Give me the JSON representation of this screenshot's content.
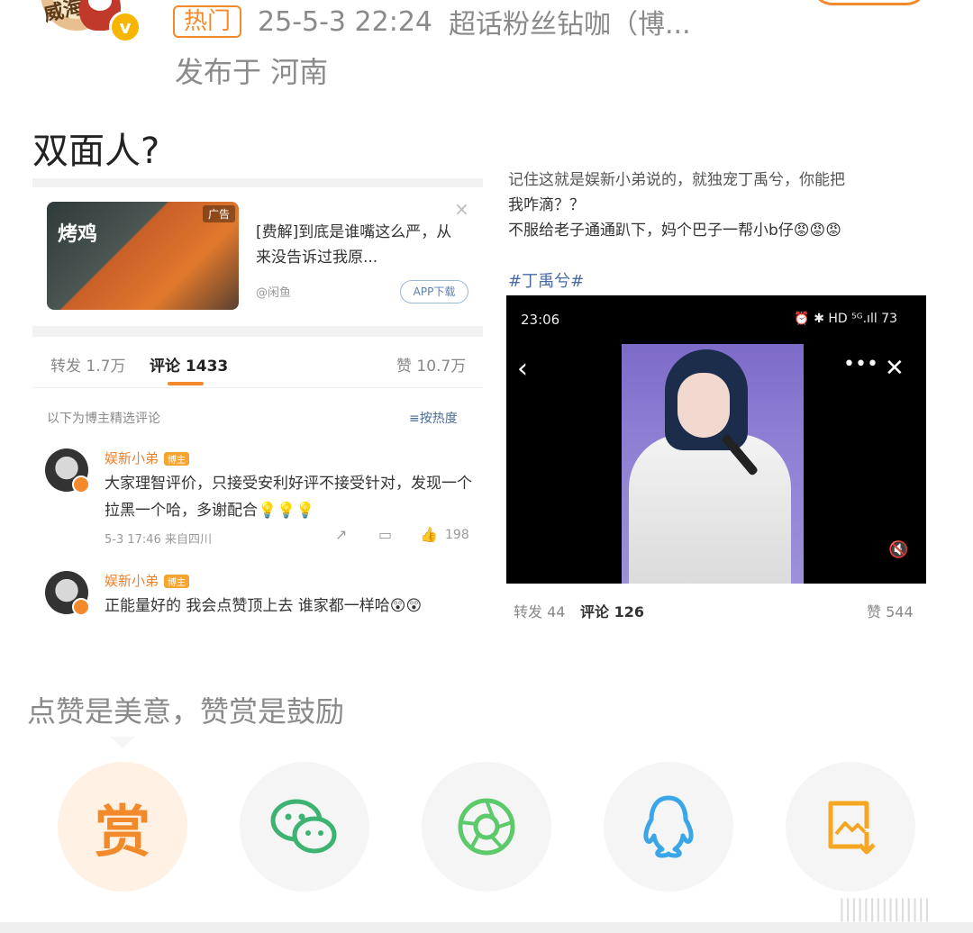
{
  "header": {
    "hot_tag": "热门",
    "timestamp": "25-5-3 22:24",
    "source": "超话粉丝钻咖（博...",
    "location": "发布于 河南",
    "avatar_text": "威海"
  },
  "post": {
    "text": "双面人?"
  },
  "left_screenshot": {
    "ad": {
      "thumb_label": "烤鸡",
      "badge": "广告",
      "close": "×",
      "title": "[费解]到底是谁嘴这么严，从来没告诉过我原...",
      "source": "@闲鱼",
      "app_button": "APP下载"
    },
    "stats": {
      "repost": "转发 1.7万",
      "comments": "评论 1433",
      "likes": "赞 10.7万"
    },
    "sort_label": "以下为博主精选评论",
    "sort_button": "≡按热度",
    "comments": [
      {
        "name": "娱新小弟",
        "badge": "博主",
        "text": "大家理智评价，只接受安利好评不接受针对，发现一个拉黑一个哈，多谢配合💡💡💡",
        "meta": "5-3 17:46 来自四川",
        "likes": "198"
      },
      {
        "name": "娱新小弟",
        "badge": "博主",
        "text": "正能量好的 我会点赞顶上去 谁家都一样哈😲😲"
      }
    ]
  },
  "right_screenshot": {
    "lines": [
      "记住这就是娱新小弟说的，就独宠丁禹兮，你能把",
      "我咋滴？？",
      "不服给老子通通趴下，妈个巴子一帮小b仔😡😡😡"
    ],
    "topic": "#丁禹兮#",
    "video": {
      "time": "23:06",
      "status": "⏰ ✱ HD ⁵ᴳ.ıll 73"
    },
    "stats": {
      "repost": "转发 44",
      "comments": "评论 126",
      "likes": "赞 544"
    }
  },
  "reward": {
    "note": "点赞是美意，赞赏是鼓励",
    "reward_label": "赏"
  },
  "colors": {
    "accent": "#f28a2b",
    "wechat": "#3cb371",
    "moments": "#5cc96a",
    "qq": "#3aa6e8",
    "save": "#f6a623"
  }
}
